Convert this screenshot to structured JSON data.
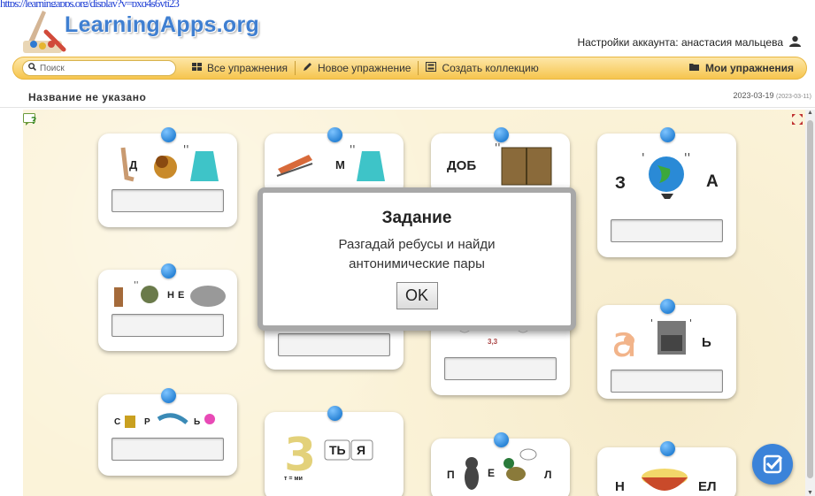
{
  "browser": {
    "top_link": "https://learningapps.org/display?v=pxq4s6ytj23"
  },
  "header": {
    "logo": "LearningApps.org",
    "account_label": "Настройки аккаунта: анастасия мальцева"
  },
  "nav": {
    "search_placeholder": "Поиск",
    "items": [
      "Все упражнения",
      "Новое упражнение",
      "Создать коллекцию"
    ],
    "my_exercises": "Мои упражнения"
  },
  "page": {
    "title": "Название не указано",
    "date": "2023-03-19",
    "date_small": "(2023-03-11)"
  },
  "cards": [
    {
      "letters": [
        "Д"
      ]
    },
    {
      "letters": [
        "М"
      ]
    },
    {
      "letters": [
        "ДОБ"
      ]
    },
    {
      "letters": [
        "З",
        "А"
      ]
    },
    {
      "letters": [
        "Н",
        "Е"
      ]
    },
    {
      "letters": []
    },
    {
      "letters": [
        "3,3"
      ]
    },
    {
      "letters": [
        "Ь"
      ]
    },
    {
      "letters": [
        "С",
        "Р",
        "Ь"
      ]
    },
    {
      "letters": [
        "ТЬ",
        "Я",
        "т = ми"
      ]
    },
    {
      "letters": [
        "П",
        "Е",
        "Л"
      ]
    },
    {
      "letters": [
        "Н",
        "ЕЛ"
      ]
    }
  ],
  "modal": {
    "title": "Задание",
    "text": "Разгадай ребусы и найди антонимические пары",
    "ok": "OK"
  },
  "colors": {
    "accent": "#3b83d9",
    "nav": "#f6c54e",
    "stage": "#fbf3d9"
  }
}
